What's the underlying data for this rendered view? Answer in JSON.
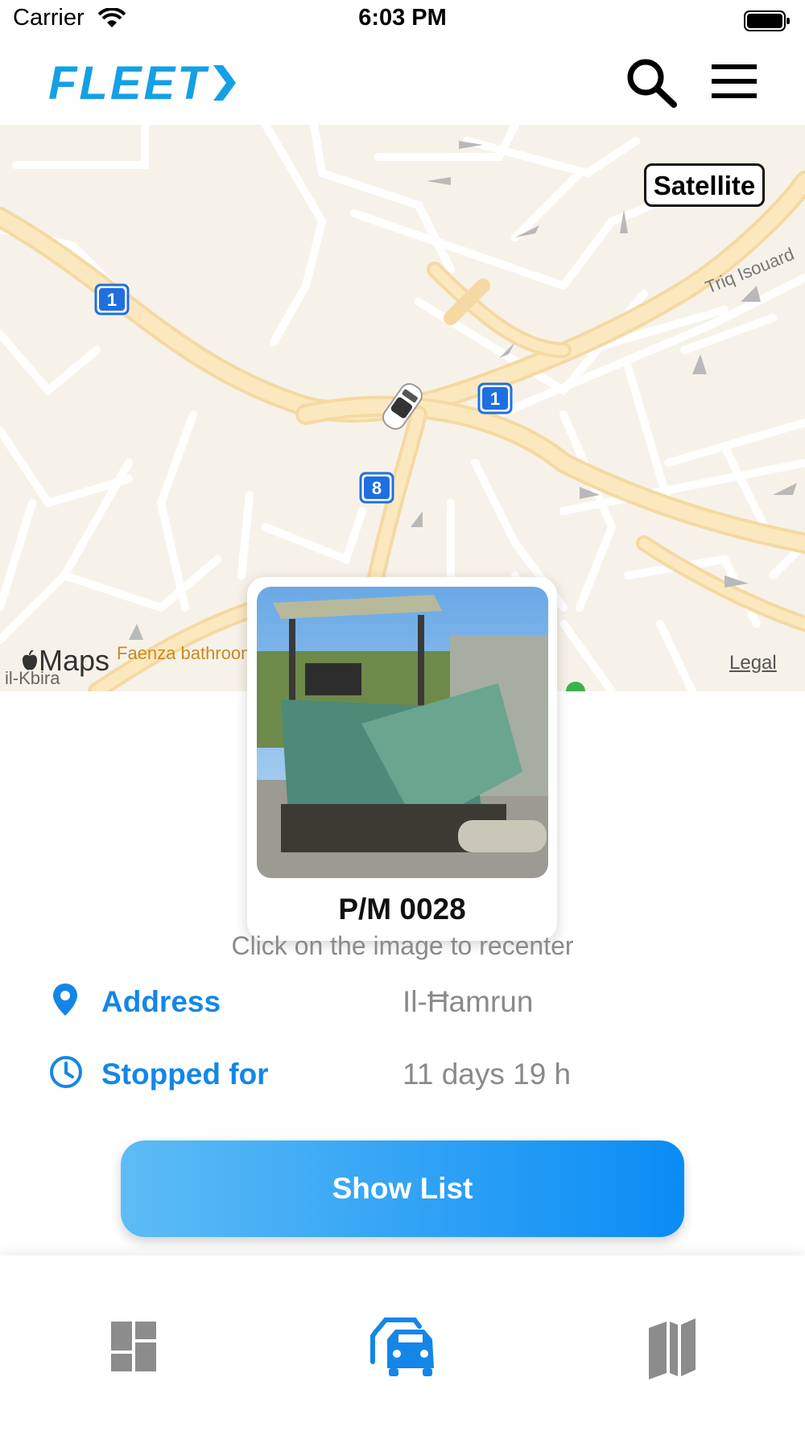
{
  "status_bar": {
    "carrier": "Carrier",
    "time": "6:03 PM"
  },
  "header": {
    "logo": "FLEET"
  },
  "map": {
    "satellite_label": "Satellite",
    "legal_label": "Legal",
    "maps_logo": "Maps",
    "poi_label": "Faenza bathrooms ma",
    "place_label": "il-Kbira",
    "street_labels": [
      "Triq",
      "Triq Isouard"
    ],
    "route_markers": [
      "1",
      "1",
      "8"
    ]
  },
  "vehicle": {
    "id": "P/M 0028",
    "recenter_hint": "Click on the image to recenter"
  },
  "info": {
    "address_label": "Address",
    "address_value": "Il-Ħamrun",
    "stopped_label": "Stopped for",
    "stopped_value": "11 days 19 h"
  },
  "actions": {
    "show_list": "Show List"
  },
  "tabs": [
    {
      "name": "dashboard",
      "icon": "dashboard-icon"
    },
    {
      "name": "vehicles",
      "icon": "car-icon",
      "active": true
    },
    {
      "name": "map",
      "icon": "map-icon"
    }
  ],
  "colors": {
    "accent": "#1486e8",
    "logo": "#14a0e6",
    "inactive_tab": "#8c8c8c"
  }
}
